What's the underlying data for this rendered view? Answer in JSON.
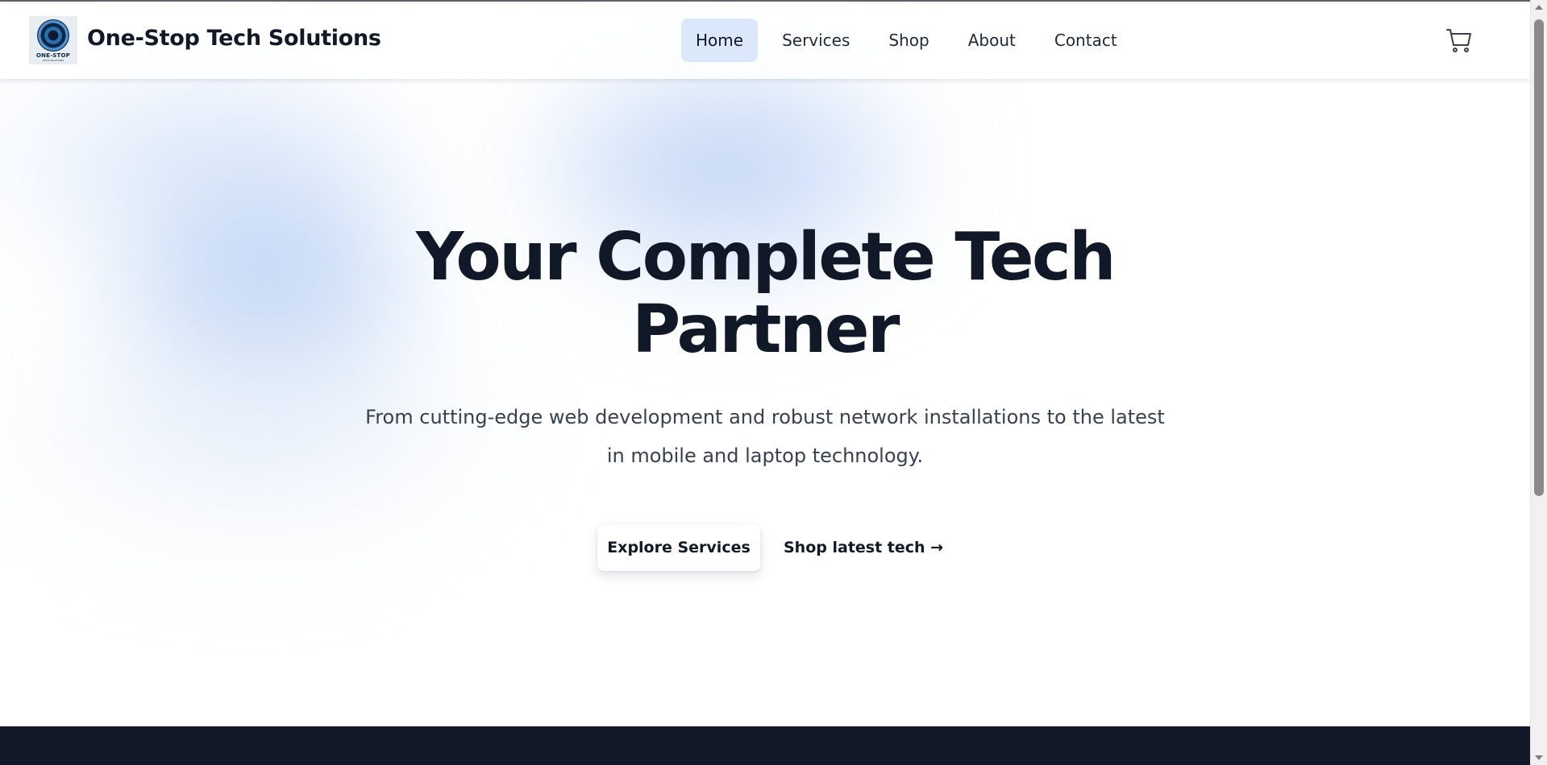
{
  "brand": {
    "name": "One-Stop Tech Solutions",
    "logo_text": "ONE-STOP",
    "logo_subtext": "TECH SOLUTIONS"
  },
  "nav": {
    "items": [
      {
        "label": "Home",
        "active": true
      },
      {
        "label": "Services",
        "active": false
      },
      {
        "label": "Shop",
        "active": false
      },
      {
        "label": "About",
        "active": false
      },
      {
        "label": "Contact",
        "active": false
      }
    ],
    "cart_icon": "shopping-cart-icon"
  },
  "hero": {
    "title_line1": "Your Complete Tech",
    "title_line2": "Partner",
    "subtitle_line1": "From cutting-edge web development and robust network installations to the latest",
    "subtitle_line2": "in mobile and laptop technology.",
    "primary_button": "Explore Services",
    "secondary_link": "Shop latest tech →"
  },
  "colors": {
    "text_dark": "#111827",
    "nav_active_bg": "#dbe8fc",
    "footer_bg": "#111827",
    "accent_blob": "#b4ccf3"
  }
}
